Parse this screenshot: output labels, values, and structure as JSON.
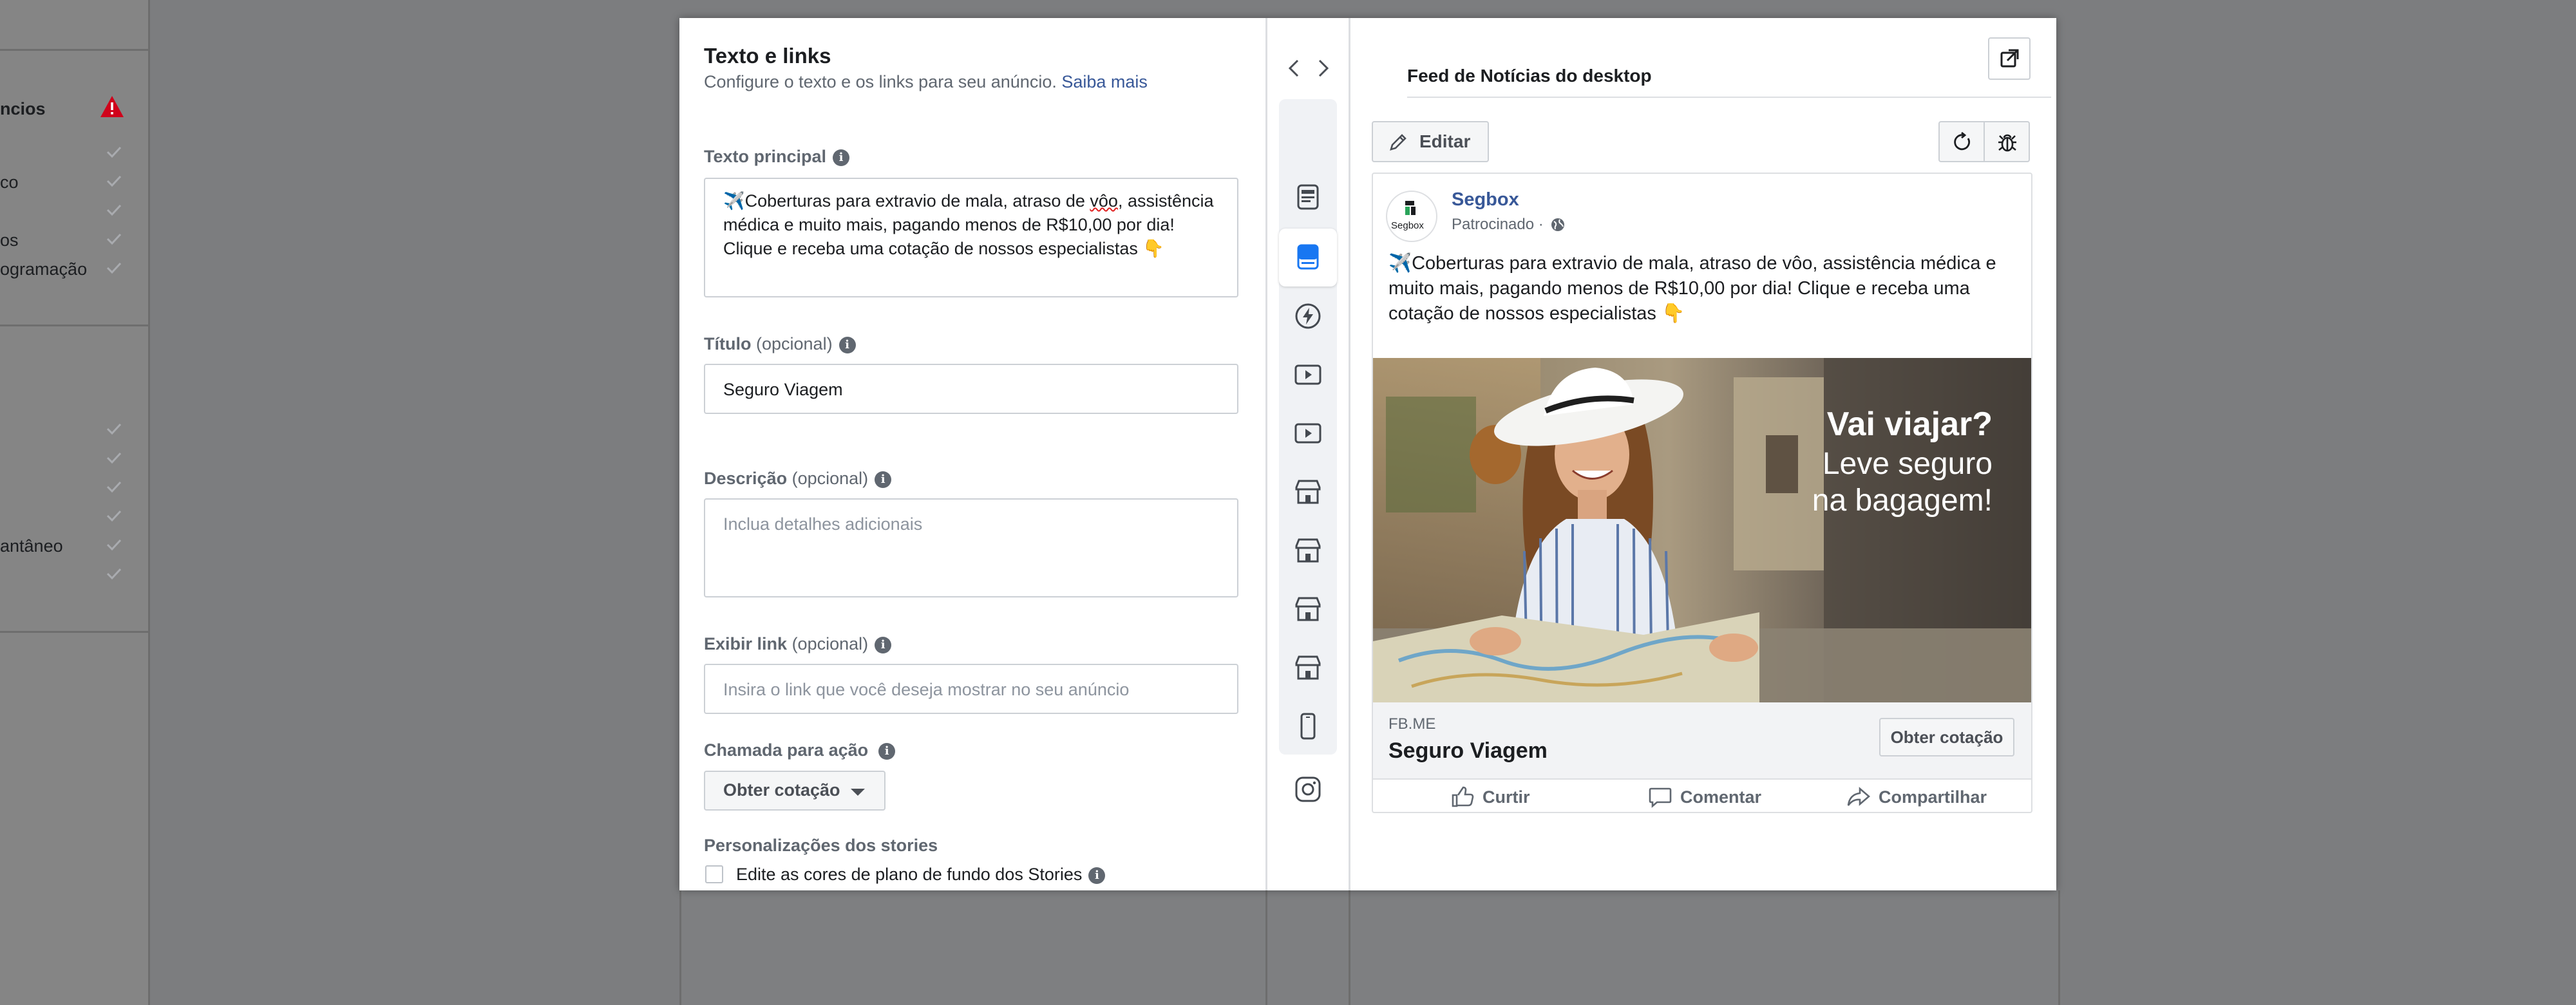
{
  "background": {
    "sidebar_items": [
      {
        "label": "ncios",
        "status": "warning"
      },
      {
        "label": "",
        "status": "check"
      },
      {
        "label": "co",
        "status": "check"
      },
      {
        "label": "",
        "status": "check"
      },
      {
        "label": "os",
        "status": "check"
      },
      {
        "label": "ogramação",
        "status": "check"
      },
      {
        "label": "",
        "status": "check"
      },
      {
        "label": "",
        "status": "check"
      },
      {
        "label": "",
        "status": "check"
      },
      {
        "label": "",
        "status": "check"
      },
      {
        "label": "antâneo",
        "status": "check"
      },
      {
        "label": "",
        "status": "check"
      }
    ]
  },
  "editor": {
    "title": "Texto e links",
    "subtitle": "Configure o texto e os links para seu anúncio.",
    "subtitle_link": "Saiba mais",
    "primary_text": {
      "label": "Texto principal",
      "value_prefix": "✈️Coberturas para extravio de mala, atraso de ",
      "value_misspelled": "vôo",
      "value_suffix": ", assistência médica e muito mais, pagando menos de R$10,00 por dia! Clique e receba uma cotação de nossos especialistas 👇"
    },
    "headline": {
      "label": "Título",
      "optional": "(opcional)",
      "value": "Seguro Viagem"
    },
    "description": {
      "label": "Descrição",
      "optional": "(opcional)",
      "placeholder": "Inclua detalhes adicionais"
    },
    "display_link": {
      "label": "Exibir link",
      "optional": "(opcional)",
      "placeholder": "Insira o link que você deseja mostrar no seu anúncio"
    },
    "cta": {
      "label": "Chamada para ação",
      "value": "Obter cotação"
    },
    "stories": {
      "label": "Personalizações dos stories",
      "checkbox_label": "Edite as cores de plano de fundo dos Stories",
      "checked": false
    }
  },
  "rail": {
    "icons": [
      "facebook-icon",
      "feed-icon",
      "desktop-feed-icon",
      "instant-articles-icon",
      "in-stream-video-icon",
      "video-feed-icon",
      "marketplace-icon",
      "marketplace-icon",
      "marketplace-icon",
      "marketplace-icon",
      "mobile-icon",
      "instagram-icon"
    ],
    "active_index": 2
  },
  "preview": {
    "title": "Feed de Notícias do desktop",
    "edit_label": "Editar",
    "post": {
      "page_name": "Segbox",
      "avatar_text": "Segbox",
      "sponsored": "Patrocinado ·",
      "text": "✈️Coberturas para extravio de mala, atraso de vôo, assistência médica e muito mais, pagando menos de R$10,00 por dia! Clique e receba uma cotação de nossos especialistas 👇",
      "image_line1": "Vai viajar?",
      "image_line2": "Leve seguro",
      "image_line3": "na bagagem!",
      "domain": "FB.ME",
      "headline": "Seguro Viagem",
      "cta": "Obter cotação",
      "actions": {
        "like": "Curtir",
        "comment": "Comentar",
        "share": "Compartilhar"
      }
    }
  },
  "colors": {
    "link": "#385898",
    "active_icon": "#1877f2",
    "warning": "#d0021b"
  }
}
